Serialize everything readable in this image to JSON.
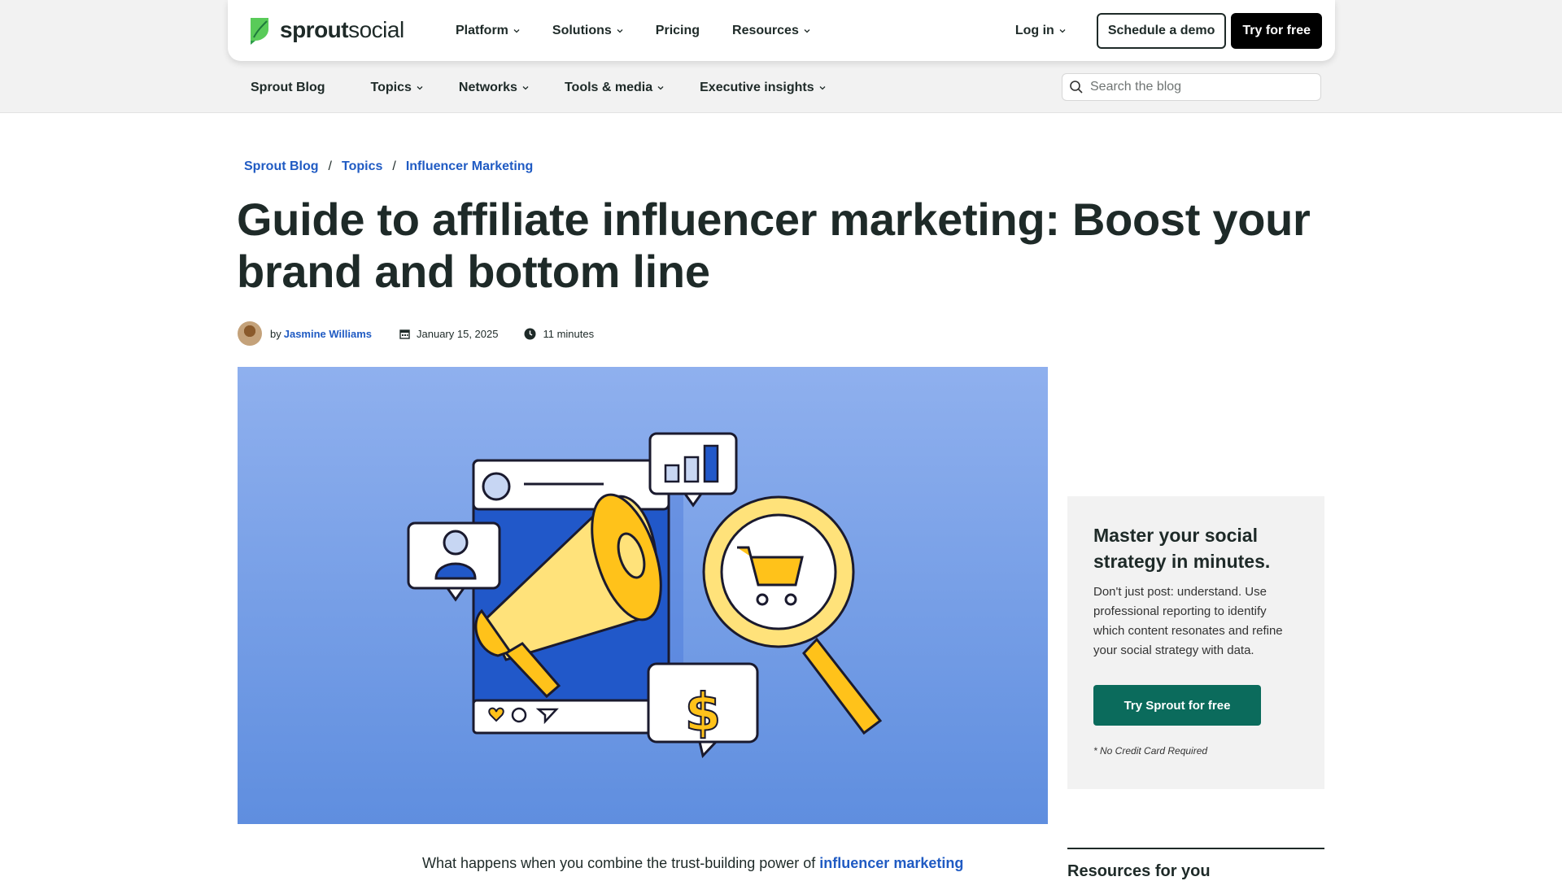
{
  "brand": {
    "name_bold": "sprout",
    "name_light": "social",
    "logo_color": "#59cb59"
  },
  "main_nav": {
    "items": [
      {
        "label": "Platform",
        "has_dropdown": true
      },
      {
        "label": "Solutions",
        "has_dropdown": true
      },
      {
        "label": "Pricing",
        "has_dropdown": false
      },
      {
        "label": "Resources",
        "has_dropdown": true
      }
    ],
    "login": "Log in",
    "demo_button": "Schedule a demo",
    "trial_button": "Try for free"
  },
  "sub_nav": {
    "items": [
      {
        "label": "Sprout Blog"
      },
      {
        "label": "Topics"
      },
      {
        "label": "Networks"
      },
      {
        "label": "Tools & media"
      },
      {
        "label": "Executive insights"
      }
    ],
    "search_placeholder": "Search the blog"
  },
  "breadcrumb": [
    "Sprout Blog",
    "Topics",
    "Influencer Marketing"
  ],
  "article": {
    "title": "Guide to affiliate influencer marketing: Boost your brand and bottom line",
    "by": "by",
    "author": "Jasmine Williams",
    "date": "January 15, 2025",
    "read_time": "11 minutes",
    "intro_start": "What happens when you combine the trust-building power of ",
    "intro_link": "influencer marketing"
  },
  "sidebar": {
    "cta_title": "Master your social strategy in minutes.",
    "cta_text": "Don't just post: understand. Use professional reporting to identify which content resonates and refine your social strategy with data.",
    "cta_button": "Try Sprout for free",
    "cta_note": "* No Credit Card Required",
    "resources_title": "Resources for you"
  },
  "colors": {
    "link": "#205bc3",
    "cta_green": "#0b6b5c",
    "hero_blue": "#7aa0e8",
    "accent_yellow": "#ffc21a"
  }
}
